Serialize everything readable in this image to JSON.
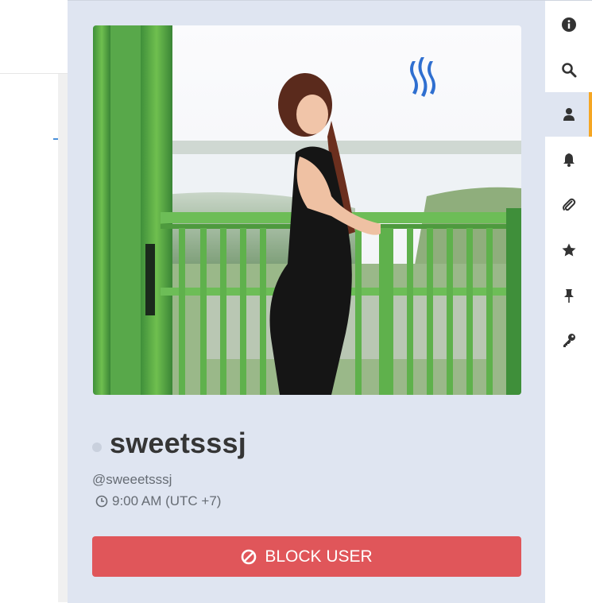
{
  "profile": {
    "display_name": "sweetsssj",
    "handle": "@sweeetsssj",
    "local_time": "9:00 AM (UTC +7)"
  },
  "actions": {
    "block_label": "BLOCK USER"
  },
  "rail": {
    "items": [
      {
        "icon": "info-icon"
      },
      {
        "icon": "search-icon"
      },
      {
        "icon": "user-icon",
        "active": true
      },
      {
        "icon": "bell-icon"
      },
      {
        "icon": "paperclip-icon"
      },
      {
        "icon": "star-icon"
      },
      {
        "icon": "pin-icon"
      },
      {
        "icon": "key-icon"
      }
    ]
  },
  "colors": {
    "panel_bg": "#dfe5f1",
    "block_button": "#e0565a",
    "active_indicator": "#f5a623",
    "rail_icon": "#333333"
  }
}
